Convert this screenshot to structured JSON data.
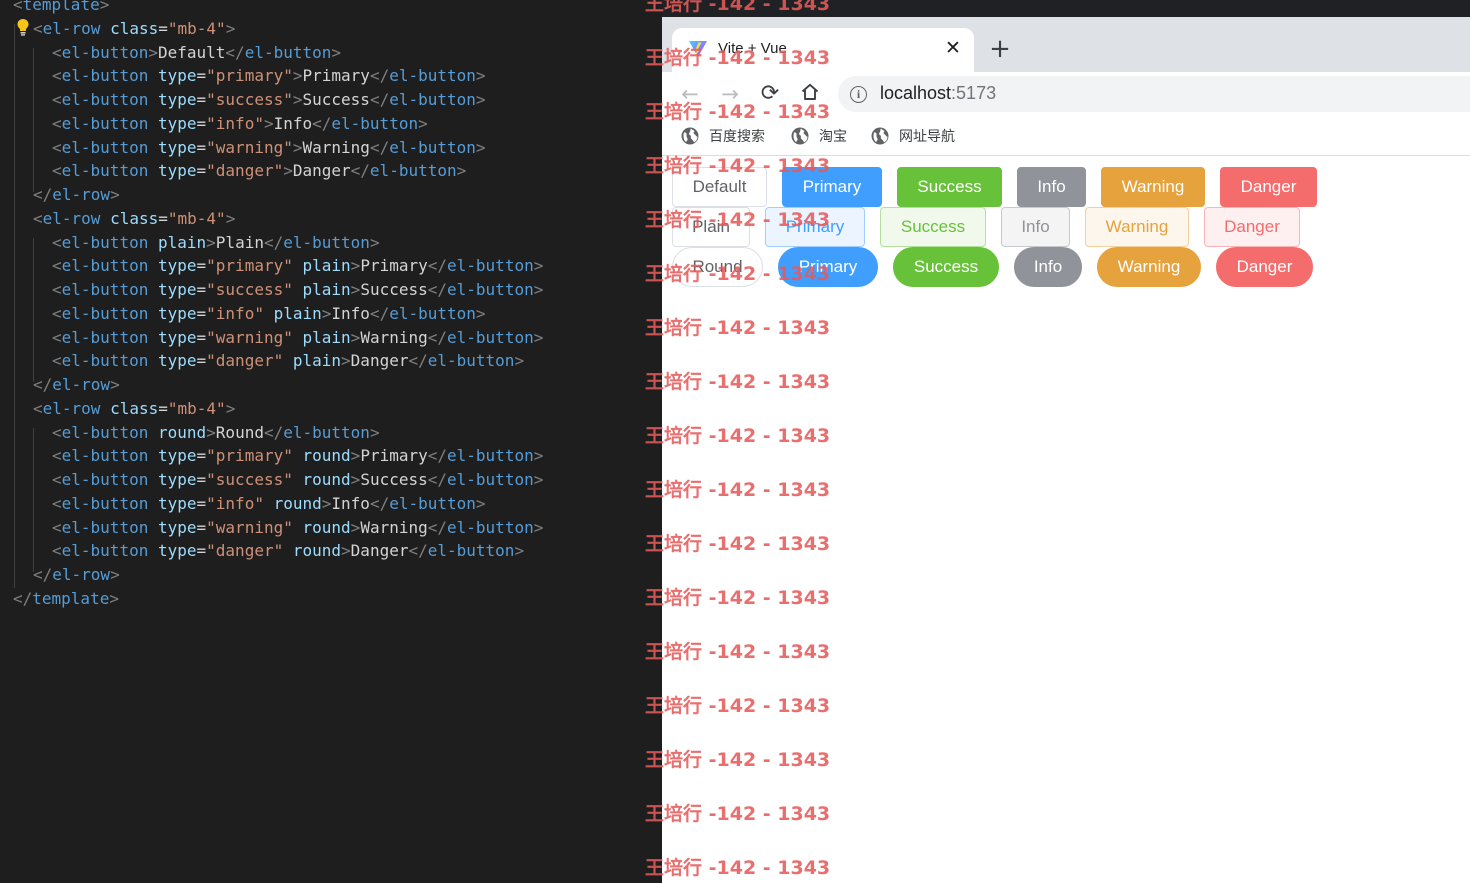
{
  "editor": {
    "lines": [
      [
        [
          "br",
          "<"
        ],
        [
          "tag",
          "template"
        ],
        [
          "br",
          ">"
        ]
      ],
      [
        [
          "br",
          "<"
        ],
        [
          "tag",
          "el-row"
        ],
        [
          "txt",
          " "
        ],
        [
          "attr",
          "class"
        ],
        [
          "txt",
          "="
        ],
        [
          "str",
          "\"mb-4\""
        ],
        [
          "br",
          ">"
        ]
      ],
      [
        [
          "br",
          "<"
        ],
        [
          "tag",
          "el-button"
        ],
        [
          "br",
          ">"
        ],
        [
          "txt",
          "Default"
        ],
        [
          "br",
          "</"
        ],
        [
          "tag",
          "el-button"
        ],
        [
          "br",
          ">"
        ]
      ],
      [
        [
          "br",
          "<"
        ],
        [
          "tag",
          "el-button"
        ],
        [
          "txt",
          " "
        ],
        [
          "attr",
          "type"
        ],
        [
          "txt",
          "="
        ],
        [
          "str",
          "\"primary\""
        ],
        [
          "br",
          ">"
        ],
        [
          "txt",
          "Primary"
        ],
        [
          "br",
          "</"
        ],
        [
          "tag",
          "el-button"
        ],
        [
          "br",
          ">"
        ]
      ],
      [
        [
          "br",
          "<"
        ],
        [
          "tag",
          "el-button"
        ],
        [
          "txt",
          " "
        ],
        [
          "attr",
          "type"
        ],
        [
          "txt",
          "="
        ],
        [
          "str",
          "\"success\""
        ],
        [
          "br",
          ">"
        ],
        [
          "txt",
          "Success"
        ],
        [
          "br",
          "</"
        ],
        [
          "tag",
          "el-button"
        ],
        [
          "br",
          ">"
        ]
      ],
      [
        [
          "br",
          "<"
        ],
        [
          "tag",
          "el-button"
        ],
        [
          "txt",
          " "
        ],
        [
          "attr",
          "type"
        ],
        [
          "txt",
          "="
        ],
        [
          "str",
          "\"info\""
        ],
        [
          "br",
          ">"
        ],
        [
          "txt",
          "Info"
        ],
        [
          "br",
          "</"
        ],
        [
          "tag",
          "el-button"
        ],
        [
          "br",
          ">"
        ]
      ],
      [
        [
          "br",
          "<"
        ],
        [
          "tag",
          "el-button"
        ],
        [
          "txt",
          " "
        ],
        [
          "attr",
          "type"
        ],
        [
          "txt",
          "="
        ],
        [
          "str",
          "\"warning\""
        ],
        [
          "br",
          ">"
        ],
        [
          "txt",
          "Warning"
        ],
        [
          "br",
          "</"
        ],
        [
          "tag",
          "el-button"
        ],
        [
          "br",
          ">"
        ]
      ],
      [
        [
          "br",
          "<"
        ],
        [
          "tag",
          "el-button"
        ],
        [
          "txt",
          " "
        ],
        [
          "attr",
          "type"
        ],
        [
          "txt",
          "="
        ],
        [
          "str",
          "\"danger\""
        ],
        [
          "br",
          ">"
        ],
        [
          "txt",
          "Danger"
        ],
        [
          "br",
          "</"
        ],
        [
          "tag",
          "el-button"
        ],
        [
          "br",
          ">"
        ]
      ],
      [
        [
          "br",
          "</"
        ],
        [
          "tag",
          "el-row"
        ],
        [
          "br",
          ">"
        ]
      ],
      [
        [
          "br",
          "<"
        ],
        [
          "tag",
          "el-row"
        ],
        [
          "txt",
          " "
        ],
        [
          "attr",
          "class"
        ],
        [
          "txt",
          "="
        ],
        [
          "str",
          "\"mb-4\""
        ],
        [
          "br",
          ">"
        ]
      ],
      [
        [
          "br",
          "<"
        ],
        [
          "tag",
          "el-button"
        ],
        [
          "txt",
          " "
        ],
        [
          "attr",
          "plain"
        ],
        [
          "br",
          ">"
        ],
        [
          "txt",
          "Plain"
        ],
        [
          "br",
          "</"
        ],
        [
          "tag",
          "el-button"
        ],
        [
          "br",
          ">"
        ]
      ],
      [
        [
          "br",
          "<"
        ],
        [
          "tag",
          "el-button"
        ],
        [
          "txt",
          " "
        ],
        [
          "attr",
          "type"
        ],
        [
          "txt",
          "="
        ],
        [
          "str",
          "\"primary\""
        ],
        [
          "txt",
          " "
        ],
        [
          "attr",
          "plain"
        ],
        [
          "br",
          ">"
        ],
        [
          "txt",
          "Primary"
        ],
        [
          "br",
          "</"
        ],
        [
          "tag",
          "el-button"
        ],
        [
          "br",
          ">"
        ]
      ],
      [
        [
          "br",
          "<"
        ],
        [
          "tag",
          "el-button"
        ],
        [
          "txt",
          " "
        ],
        [
          "attr",
          "type"
        ],
        [
          "txt",
          "="
        ],
        [
          "str",
          "\"success\""
        ],
        [
          "txt",
          " "
        ],
        [
          "attr",
          "plain"
        ],
        [
          "br",
          ">"
        ],
        [
          "txt",
          "Success"
        ],
        [
          "br",
          "</"
        ],
        [
          "tag",
          "el-button"
        ],
        [
          "br",
          ">"
        ]
      ],
      [
        [
          "br",
          "<"
        ],
        [
          "tag",
          "el-button"
        ],
        [
          "txt",
          " "
        ],
        [
          "attr",
          "type"
        ],
        [
          "txt",
          "="
        ],
        [
          "str",
          "\"info\""
        ],
        [
          "txt",
          " "
        ],
        [
          "attr",
          "plain"
        ],
        [
          "br",
          ">"
        ],
        [
          "txt",
          "Info"
        ],
        [
          "br",
          "</"
        ],
        [
          "tag",
          "el-button"
        ],
        [
          "br",
          ">"
        ]
      ],
      [
        [
          "br",
          "<"
        ],
        [
          "tag",
          "el-button"
        ],
        [
          "txt",
          " "
        ],
        [
          "attr",
          "type"
        ],
        [
          "txt",
          "="
        ],
        [
          "str",
          "\"warning\""
        ],
        [
          "txt",
          " "
        ],
        [
          "attr",
          "plain"
        ],
        [
          "br",
          ">"
        ],
        [
          "txt",
          "Warning"
        ],
        [
          "br",
          "</"
        ],
        [
          "tag",
          "el-button"
        ],
        [
          "br",
          ">"
        ]
      ],
      [
        [
          "br",
          "<"
        ],
        [
          "tag",
          "el-button"
        ],
        [
          "txt",
          " "
        ],
        [
          "attr",
          "type"
        ],
        [
          "txt",
          "="
        ],
        [
          "str",
          "\"danger\""
        ],
        [
          "txt",
          " "
        ],
        [
          "attr",
          "plain"
        ],
        [
          "br",
          ">"
        ],
        [
          "txt",
          "Danger"
        ],
        [
          "br",
          "</"
        ],
        [
          "tag",
          "el-button"
        ],
        [
          "br",
          ">"
        ]
      ],
      [
        [
          "br",
          "</"
        ],
        [
          "tag",
          "el-row"
        ],
        [
          "br",
          ">"
        ]
      ],
      [
        [
          "br",
          "<"
        ],
        [
          "tag",
          "el-row"
        ],
        [
          "txt",
          " "
        ],
        [
          "attr",
          "class"
        ],
        [
          "txt",
          "="
        ],
        [
          "str",
          "\"mb-4\""
        ],
        [
          "br",
          ">"
        ]
      ],
      [
        [
          "br",
          "<"
        ],
        [
          "tag",
          "el-button"
        ],
        [
          "txt",
          " "
        ],
        [
          "attr",
          "round"
        ],
        [
          "br",
          ">"
        ],
        [
          "txt",
          "Round"
        ],
        [
          "br",
          "</"
        ],
        [
          "tag",
          "el-button"
        ],
        [
          "br",
          ">"
        ]
      ],
      [
        [
          "br",
          "<"
        ],
        [
          "tag",
          "el-button"
        ],
        [
          "txt",
          " "
        ],
        [
          "attr",
          "type"
        ],
        [
          "txt",
          "="
        ],
        [
          "str",
          "\"primary\""
        ],
        [
          "txt",
          " "
        ],
        [
          "attr",
          "round"
        ],
        [
          "br",
          ">"
        ],
        [
          "txt",
          "Primary"
        ],
        [
          "br",
          "</"
        ],
        [
          "tag",
          "el-button"
        ],
        [
          "br",
          ">"
        ]
      ],
      [
        [
          "br",
          "<"
        ],
        [
          "tag",
          "el-button"
        ],
        [
          "txt",
          " "
        ],
        [
          "attr",
          "type"
        ],
        [
          "txt",
          "="
        ],
        [
          "str",
          "\"success\""
        ],
        [
          "txt",
          " "
        ],
        [
          "attr",
          "round"
        ],
        [
          "br",
          ">"
        ],
        [
          "txt",
          "Success"
        ],
        [
          "br",
          "</"
        ],
        [
          "tag",
          "el-button"
        ],
        [
          "br",
          ">"
        ]
      ],
      [
        [
          "br",
          "<"
        ],
        [
          "tag",
          "el-button"
        ],
        [
          "txt",
          " "
        ],
        [
          "attr",
          "type"
        ],
        [
          "txt",
          "="
        ],
        [
          "str",
          "\"info\""
        ],
        [
          "txt",
          " "
        ],
        [
          "attr",
          "round"
        ],
        [
          "br",
          ">"
        ],
        [
          "txt",
          "Info"
        ],
        [
          "br",
          "</"
        ],
        [
          "tag",
          "el-button"
        ],
        [
          "br",
          ">"
        ]
      ],
      [
        [
          "br",
          "<"
        ],
        [
          "tag",
          "el-button"
        ],
        [
          "txt",
          " "
        ],
        [
          "attr",
          "type"
        ],
        [
          "txt",
          "="
        ],
        [
          "str",
          "\"warning\""
        ],
        [
          "txt",
          " "
        ],
        [
          "attr",
          "round"
        ],
        [
          "br",
          ">"
        ],
        [
          "txt",
          "Warning"
        ],
        [
          "br",
          "</"
        ],
        [
          "tag",
          "el-button"
        ],
        [
          "br",
          ">"
        ]
      ],
      [
        [
          "br",
          "<"
        ],
        [
          "tag",
          "el-button"
        ],
        [
          "txt",
          " "
        ],
        [
          "attr",
          "type"
        ],
        [
          "txt",
          "="
        ],
        [
          "str",
          "\"danger\""
        ],
        [
          "txt",
          " "
        ],
        [
          "attr",
          "round"
        ],
        [
          "br",
          ">"
        ],
        [
          "txt",
          "Danger"
        ],
        [
          "br",
          "</"
        ],
        [
          "tag",
          "el-button"
        ],
        [
          "br",
          ">"
        ]
      ],
      [
        [
          "br",
          "</"
        ],
        [
          "tag",
          "el-row"
        ],
        [
          "br",
          ">"
        ]
      ],
      [
        [
          "br",
          "</"
        ],
        [
          "tag",
          "template"
        ],
        [
          "br",
          ">"
        ]
      ]
    ],
    "colors": {
      "bracket": "#808080",
      "tag": "#569cd6",
      "attribute": "#9cdcfe",
      "string": "#ce9178",
      "text": "#d4d4d4"
    }
  },
  "browser": {
    "tab_title": "Vite + Vue",
    "tab_close": "✕",
    "new_tab": "+",
    "nav": {
      "back": "←",
      "forward": "→",
      "reload": "⟳",
      "home": "⌂"
    },
    "url_host": "localhost",
    "url_port": ":5173",
    "info_glyph": "i",
    "bookmarks": [
      "百度搜索",
      "淘宝",
      "网址导航"
    ]
  },
  "page": {
    "rows": [
      {
        "variant": "default",
        "buttons": [
          {
            "label": "Default",
            "type": "default"
          },
          {
            "label": "Primary",
            "type": "primary"
          },
          {
            "label": "Success",
            "type": "success"
          },
          {
            "label": "Info",
            "type": "info"
          },
          {
            "label": "Warning",
            "type": "warning"
          },
          {
            "label": "Danger",
            "type": "danger"
          }
        ]
      },
      {
        "variant": "plain",
        "buttons": [
          {
            "label": "Plain",
            "type": "default"
          },
          {
            "label": "Primary",
            "type": "primary"
          },
          {
            "label": "Success",
            "type": "success"
          },
          {
            "label": "Info",
            "type": "info"
          },
          {
            "label": "Warning",
            "type": "warning"
          },
          {
            "label": "Danger",
            "type": "danger"
          }
        ]
      },
      {
        "variant": "round",
        "buttons": [
          {
            "label": "Round",
            "type": "default"
          },
          {
            "label": "Primary",
            "type": "primary"
          },
          {
            "label": "Success",
            "type": "success"
          },
          {
            "label": "Info",
            "type": "info"
          },
          {
            "label": "Warning",
            "type": "warning"
          },
          {
            "label": "Danger",
            "type": "danger"
          }
        ]
      }
    ],
    "theme": {
      "primary": "#409eff",
      "success": "#67c23a",
      "info": "#909399",
      "warning": "#e6a23c",
      "danger": "#f56c6c",
      "default_border": "#dcdfe6",
      "default_text": "#606266",
      "plain_backgrounds": {
        "primary": "#ecf5ff",
        "success": "#f0f9eb",
        "info": "#f4f4f5",
        "warning": "#fdf6ec",
        "danger": "#fef0f0"
      },
      "plain_borders": {
        "primary": "#a0cfff",
        "success": "#b3e19d",
        "info": "#c8c9cc",
        "warning": "#f3d19e",
        "danger": "#fab6b6"
      }
    }
  },
  "watermark": {
    "text": "王培行 -142 - 1343",
    "color": "#e65a5a"
  }
}
